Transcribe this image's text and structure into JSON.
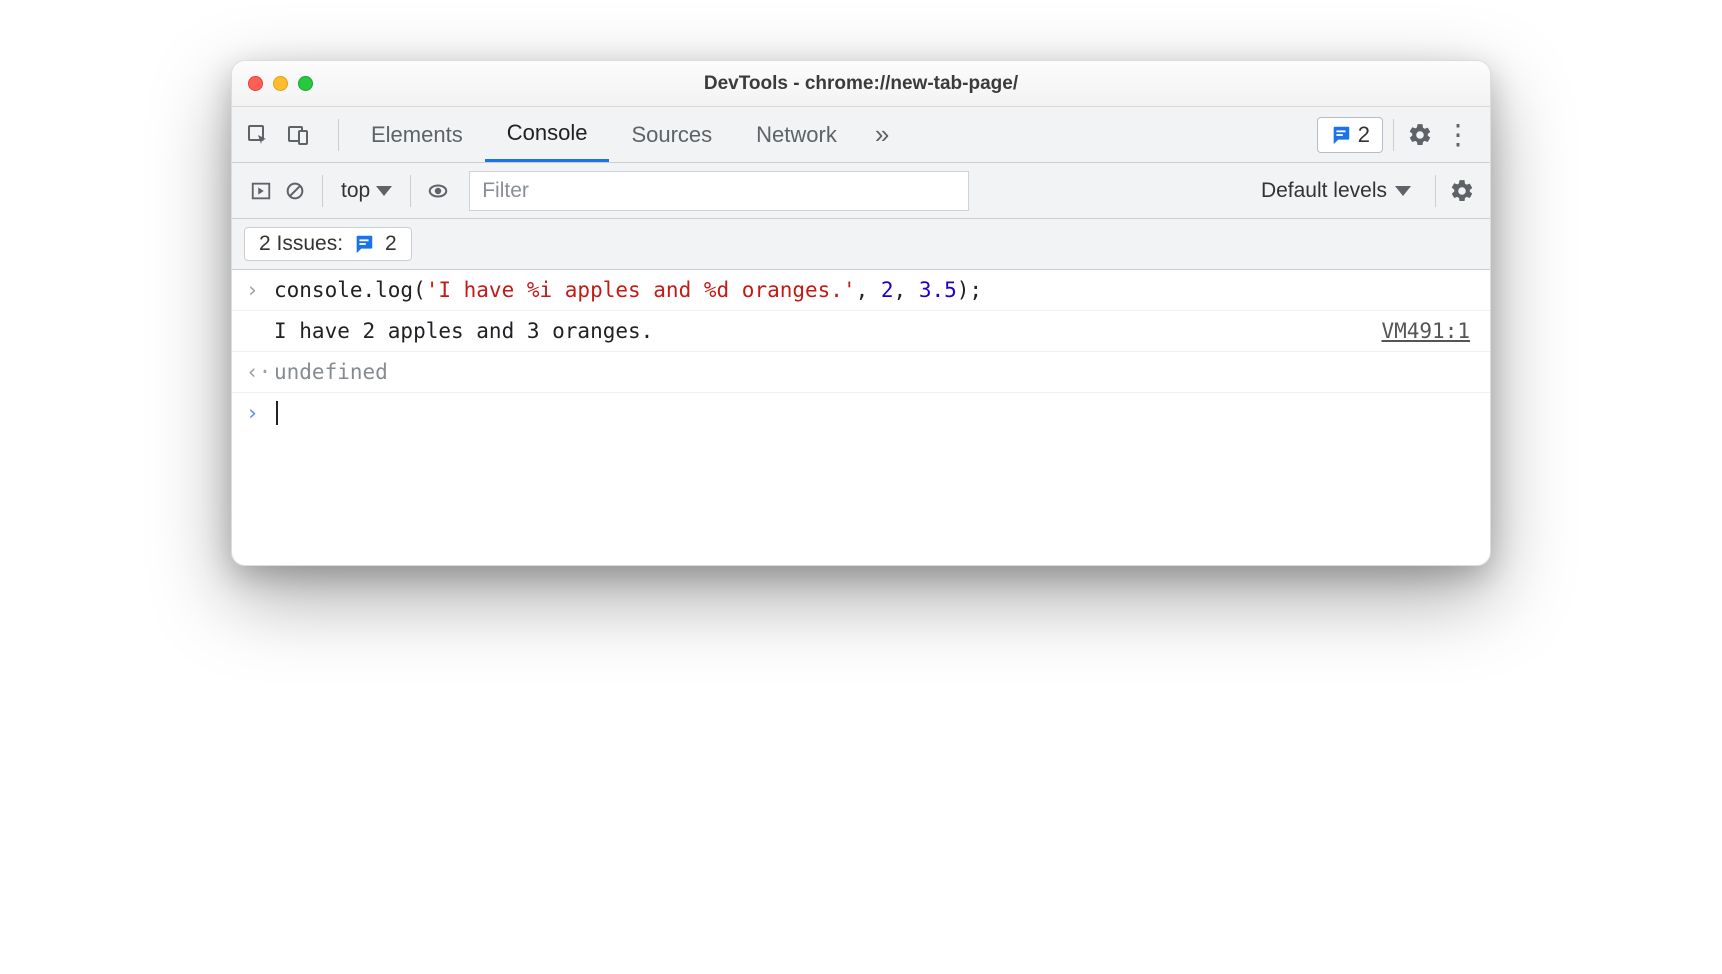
{
  "window": {
    "title": "DevTools - chrome://new-tab-page/"
  },
  "tabs": {
    "elements": "Elements",
    "console": "Console",
    "sources": "Sources",
    "network": "Network",
    "overflow": "»"
  },
  "topbar": {
    "issues_count": "2"
  },
  "toolbar": {
    "context": "top",
    "filter_placeholder": "Filter",
    "levels_label": "Default levels"
  },
  "issues": {
    "label_prefix": "2 Issues:",
    "count": "2"
  },
  "console": {
    "input_prefix": "console.log(",
    "input_string": "'I have %i apples and %d oranges.'",
    "input_sep1": ", ",
    "input_arg1": "2",
    "input_sep2": ", ",
    "input_arg2": "3.5",
    "input_suffix": ");",
    "output": "I have 2 apples and 3 oranges.",
    "source": "VM491:1",
    "return": "undefined"
  }
}
